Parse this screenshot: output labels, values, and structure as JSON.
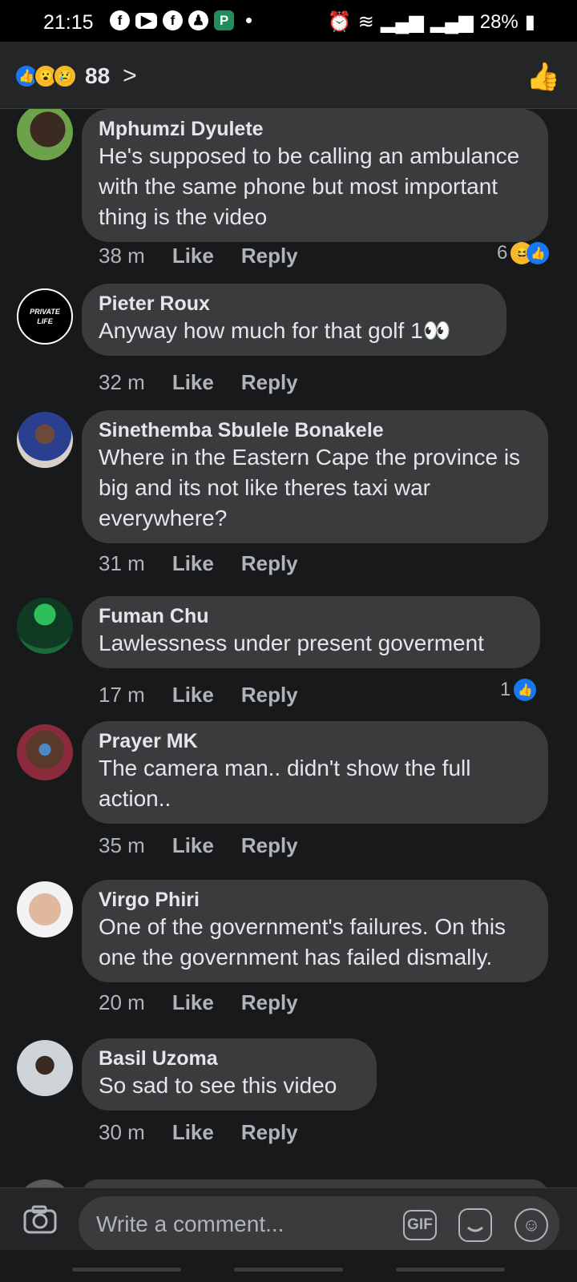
{
  "status": {
    "time": "21:15",
    "battery": "28%"
  },
  "header": {
    "reaction_count": "88"
  },
  "comments": [
    {
      "author": "Mphumzi Dyulete",
      "text": "He's supposed to be calling an ambulance with the same phone but most important thing is the video",
      "time": "38 m",
      "like": "Like",
      "reply": "Reply",
      "reaction_count": "6"
    },
    {
      "author": "Pieter Roux",
      "text": "Anyway how much for that golf 1👀",
      "time": "32 m",
      "like": "Like",
      "reply": "Reply"
    },
    {
      "author": "Sinethemba Sbulele Bonakele",
      "text": "Where in the Eastern Cape the province is big and its not like theres taxi war everywhere?",
      "time": "31 m",
      "like": "Like",
      "reply": "Reply"
    },
    {
      "author": "Fuman Chu",
      "text": "Lawlessness under present goverment",
      "time": "17 m",
      "like": "Like",
      "reply": "Reply",
      "reaction_count": "1"
    },
    {
      "author": "Prayer MK",
      "text": "The camera man.. didn't show the full action..",
      "time": "35 m",
      "like": "Like",
      "reply": "Reply"
    },
    {
      "author": "Virgo Phiri",
      "text": "One of the government's failures. On this one the government has failed dismally.",
      "time": "20 m",
      "like": "Like",
      "reply": "Reply"
    },
    {
      "author": "Basil Uzoma",
      "text": "So sad to see this video",
      "time": "30 m",
      "like": "Like",
      "reply": "Reply"
    }
  ],
  "avatar_labels": {
    "pieter": "PRIVATE LIFE"
  },
  "composer": {
    "placeholder": "Write a comment...",
    "gif": "GIF"
  },
  "colors": {
    "background": "#18191a",
    "bubble": "#3a3b3c",
    "accent": "#1877f2"
  }
}
